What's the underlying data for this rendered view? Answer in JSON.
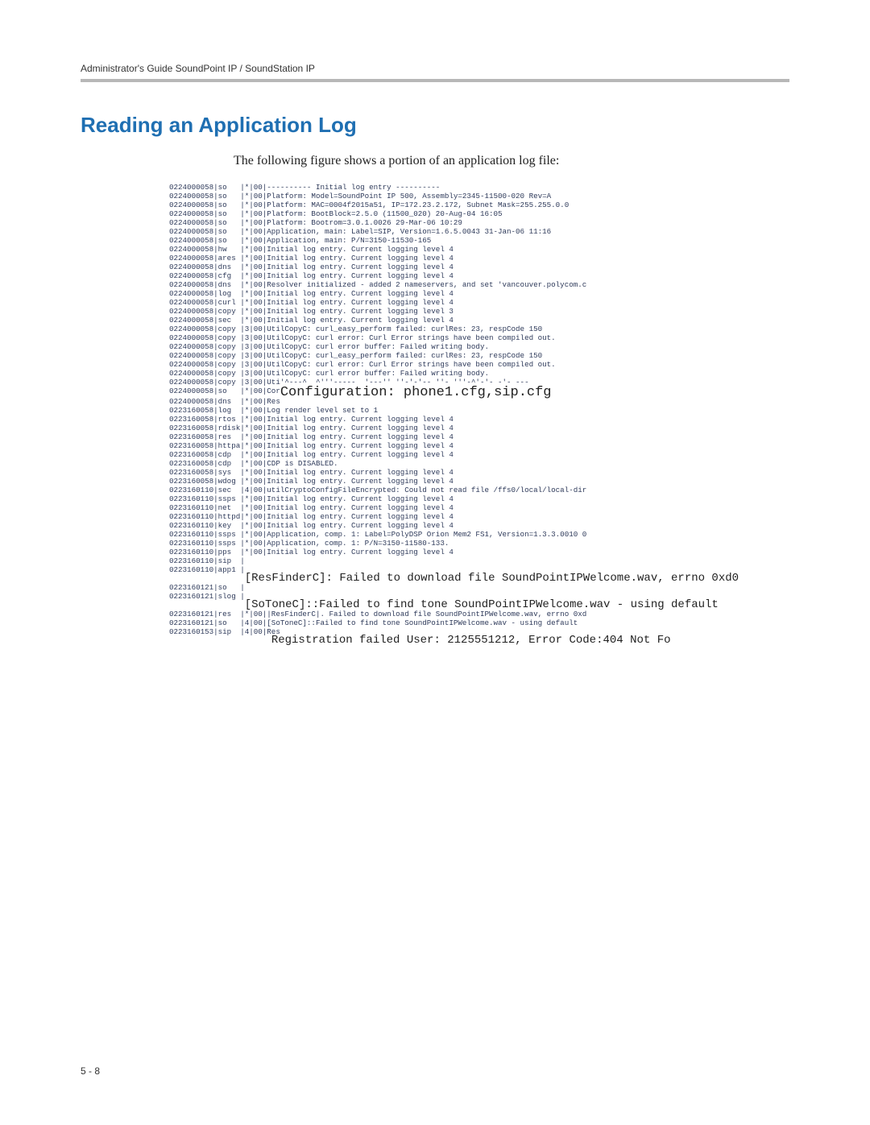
{
  "header": {
    "running": "Administrator's Guide SoundPoint IP / SoundStation IP"
  },
  "section": {
    "title": "Reading an Application Log",
    "intro": "The following figure shows a portion of an application log file:"
  },
  "log": {
    "lines": [
      "0224000058|so   |*|00|---------- Initial log entry ----------",
      "0224000058|so   |*|00|Platform: Model=SoundPoint IP 500, Assembly=2345-11500-020 Rev=A",
      "0224000058|so   |*|00|Platform: MAC=0004f2015a51, IP=172.23.2.172, Subnet Mask=255.255.0.0",
      "0224000058|so   |*|00|Platform: BootBlock=2.5.0 (11500_020) 20-Aug-04 16:05",
      "0224000058|so   |*|00|Platform: Bootrom=3.0.1.0026 29-Mar-06 10:29",
      "0224000058|so   |*|00|Application, main: Label=SIP, Version=1.6.5.0043 31-Jan-06 11:16",
      "0224000058|so   |*|00|Application, main: P/N=3150-11530-165",
      "0224000058|hw   |*|00|Initial log entry. Current logging level 4",
      "0224000058|ares |*|00|Initial log entry. Current logging level 4",
      "0224000058|dns  |*|00|Initial log entry. Current logging level 4",
      "0224000058|cfg  |*|00|Initial log entry. Current logging level 4",
      "0224000058|dns  |*|00|Resolver initialized - added 2 nameservers, and set 'vancouver.polycom.c",
      "0224000058|log  |*|00|Initial log entry. Current logging level 4",
      "0224000058|curl |*|00|Initial log entry. Current logging level 4",
      "0224000058|copy |*|00|Initial log entry. Current logging level 3",
      "0224000058|sec  |*|00|Initial log entry. Current logging level 4",
      "0224000058|copy |3|00|UtilCopyC: curl_easy_perform failed: curlRes: 23, respCode 150",
      "0224000058|copy |3|00|UtilCopyC: curl error: Curl Error strings have been compiled out.",
      "0224000058|copy |3|00|UtilCopyC: curl error buffer: Failed writing body.",
      "0224000058|copy |3|00|UtilCopyC: curl_easy_perform failed: curlRes: 23, respCode 150",
      "0224000058|copy |3|00|UtilCopyC: curl error: Curl Error strings have been compiled out.",
      "0224000058|copy |3|00|UtilCopyC: curl error buffer: Failed writing body.",
      "0224000058|copy |3|00|Uti'^---^  ^'''-----  '---'' ''-'-'-- ''- '''-^'-'- -'- ---"
    ],
    "overlay_cfg_prefix_a": "0224000058|so   |*|00|Cor",
    "overlay_cfg_text": "Configuration: phone1.cfg,sip.cfg",
    "overlay_cfg_prefix_b": "0224000058|dns  |*|00|Res",
    "lines2": [
      "0223160058|log  |*|00|Log render level set to 1",
      "0223160058|rtos |*|00|Initial log entry. Current logging level 4",
      "0223160058|rdisk|*|00|Initial log entry. Current logging level 4",
      "0223160058|res  |*|00|Initial log entry. Current logging level 4",
      "0223160058|httpa|*|00|Initial log entry. Current logging level 4",
      "0223160058|cdp  |*|00|Initial log entry. Current logging level 4",
      "0223160058|cdp  |*|00|CDP is DISABLED.",
      "0223160058|sys  |*|00|Initial log entry. Current logging level 4",
      "0223160058|wdog |*|00|Initial log entry. Current logging level 4",
      "0223160110|sec  |4|00|utilCryptoConfigFileEncrypted: Could not read file /ffs0/local/local-dir",
      "0223160110|ssps |*|00|Initial log entry. Current logging level 4",
      "0223160110|net  |*|00|Initial log entry. Current logging level 4",
      "0223160110|httpd|*|00|Initial log entry. Current logging level 4",
      "0223160110|key  |*|00|Initial log entry. Current logging level 4",
      "0223160110|ssps |*|00|Application, comp. 1: Label=PolyDSP Orion Mem2 FS1, Version=1.3.3.0010 0",
      "0223160110|ssps |*|00|Application, comp. 1: P/N=3150-11580-133.",
      "0223160110|pps  |*|00|Initial log entry. Current logging level 4",
      "0223160110|sip  |",
      "0223160110|app1 |"
    ],
    "overlay_res_text": "[ResFinderC]: Failed to download file SoundPointIPWelcome.wav, errno 0xd0",
    "lines3": [
      "0223160121|so   |",
      "0223160121|slog |"
    ],
    "overlay_tone_text": "[SoToneC]::Failed to find tone SoundPointIPWelcome.wav - using default",
    "lines4": [
      "0223160121|res  |*|00||ResFinderC|. Failed to download file SoundPointIPWelcome.wav, errno 0xd",
      "0223160121|so   |4|00|[SoToneC]::Failed to find tone SoundPointIPWelcome.wav - using default",
      "0223160153|sip  |4|00|Res"
    ],
    "overlay_reg_text": "Registration failed User: 2125551212, Error Code:404 Not Fo"
  },
  "footer": {
    "pagenum": "5 - 8"
  }
}
